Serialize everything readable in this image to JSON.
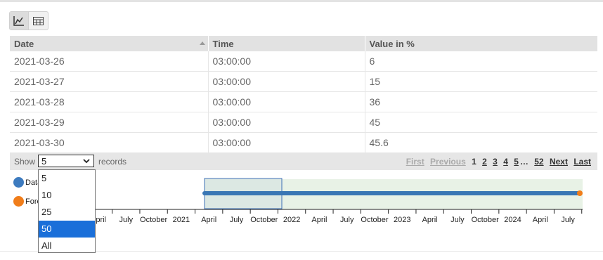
{
  "view_toggle": {
    "chart_icon": "line-chart-icon",
    "table_icon": "table-icon",
    "active": "chart"
  },
  "table": {
    "columns": [
      "Date",
      "Time",
      "Value in %"
    ],
    "rows": [
      [
        "2021-03-26",
        "03:00:00",
        "6"
      ],
      [
        "2021-03-27",
        "03:00:00",
        "15"
      ],
      [
        "2021-03-28",
        "03:00:00",
        "36"
      ],
      [
        "2021-03-29",
        "03:00:00",
        "45"
      ],
      [
        "2021-03-30",
        "03:00:00",
        "45.6"
      ]
    ]
  },
  "footer": {
    "show_label": "Show",
    "records_label": "records",
    "selected_page_size": "5",
    "page_size_options": [
      "5",
      "10",
      "25",
      "50",
      "All"
    ],
    "highlighted_option": "50",
    "pager": {
      "first": "First",
      "previous": "Previous",
      "pages": [
        "1",
        "2",
        "3",
        "4",
        "5"
      ],
      "ellipsis": "…",
      "last_page": "52",
      "next": "Next",
      "last": "Last",
      "current": "1"
    }
  },
  "navigator": {
    "legend": [
      {
        "label": "Data",
        "color": "#3d7bbf"
      },
      {
        "label": "Forecast",
        "color": "#f07d1a"
      }
    ],
    "axis_labels": [
      "April",
      "July",
      "October",
      "2021",
      "April",
      "July",
      "October",
      "2022",
      "April",
      "July",
      "October",
      "2023",
      "April",
      "July",
      "October",
      "2024",
      "April",
      "July"
    ],
    "colors": {
      "data_line": "#3a77b4",
      "forecast_dot": "#f07d1a",
      "range_fill": "#e8f2e6",
      "selection_fill": "#d9e6e2",
      "selection_border": "#3d6fb5"
    }
  }
}
